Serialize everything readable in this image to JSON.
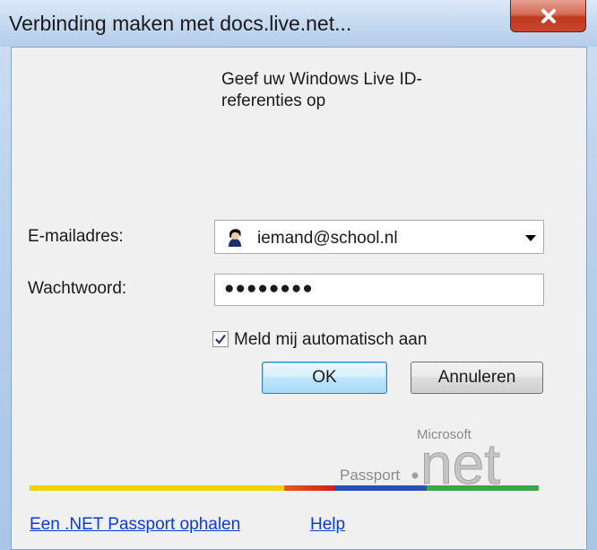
{
  "window": {
    "title": "Verbinding maken met docs.live.net..."
  },
  "dialog": {
    "prompt": "Geef uw Windows Live ID-referenties op",
    "email_label": "E-mailadres:",
    "email_value": "iemand@school.nl",
    "password_label": "Wachtwoord:",
    "password_value": "●●●●●●●●",
    "auto_signin_label": "Meld mij automatisch aan",
    "auto_signin_checked": true,
    "ok_label": "OK",
    "cancel_label": "Annuleren"
  },
  "logo": {
    "microsoft_text": "Microsoft",
    "passport_text": "Passport",
    "net_text": "net"
  },
  "links": {
    "get_passport": "Een .NET Passport ophalen",
    "help": "Help"
  },
  "colors": {
    "close_button": "#c9452c",
    "link": "#0d3bd6",
    "ok_border": "#3c7fb1"
  }
}
